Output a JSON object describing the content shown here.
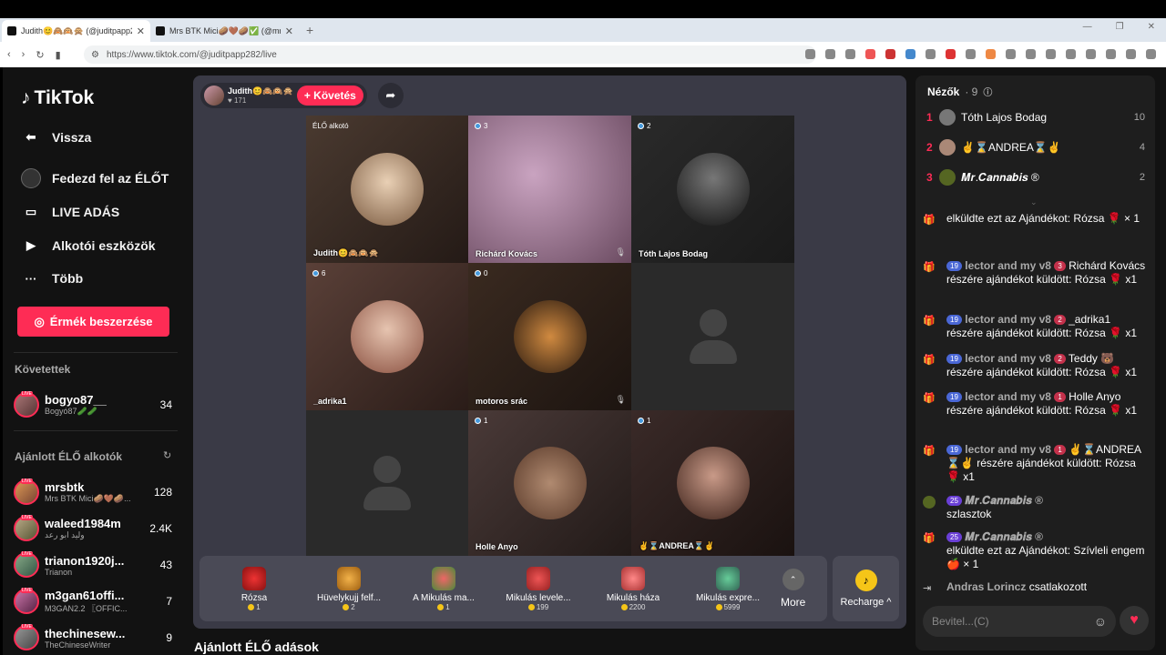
{
  "browser": {
    "tabs": [
      {
        "label": "Judith😊🙈🙉🙊 (@juditpapp282) TikTok LIVE",
        "active": true
      },
      {
        "label": "Mrs BTK Mici🥔🤎🥔✅ (@mrsbtk)",
        "active": false
      }
    ],
    "url": "https://www.tiktok.com/@juditpapp282/live"
  },
  "sidebar": {
    "logo": "TikTok",
    "back": "Vissza",
    "nav": [
      {
        "label": "Fedezd fel az ÉLŐT",
        "icon": "live-explore-icon"
      },
      {
        "label": "LIVE ADÁS",
        "icon": "video-camera-icon"
      },
      {
        "label": "Alkotói eszközök",
        "icon": "creator-tools-icon"
      },
      {
        "label": "Több",
        "icon": "more-dots-icon"
      }
    ],
    "coin_button": "Érmék beszerzése",
    "followed_heading": "Követettek",
    "followed": [
      {
        "name": "bogyo87__",
        "sub": "Bogyó87🥒🥒",
        "count": "34"
      }
    ],
    "recommended_heading": "Ajánlott ÉLŐ alkotók",
    "recommended": [
      {
        "name": "mrsbtk",
        "sub": "Mrs BTK Mici🥔🤎🥔...",
        "count": "128"
      },
      {
        "name": "waleed1984m",
        "sub": "وليد ابو رعد",
        "count": "2.4K"
      },
      {
        "name": "trianon1920j...",
        "sub": "Trianon",
        "count": "43"
      },
      {
        "name": "m3gan61offi...",
        "sub": "M3GAN2.2 〖OFFIC...",
        "count": "7"
      },
      {
        "name": "thechinesew...",
        "sub": "TheChineseWriter",
        "count": "9"
      }
    ]
  },
  "host": {
    "name": "Judith😊🙈🙉🙊",
    "likes": "171",
    "follow_label": "+ Követés"
  },
  "grid": [
    {
      "name": "Judith😊🙈🙉🙊",
      "count": "",
      "tag": "ÉLŐ alkotó",
      "muted": false
    },
    {
      "name": "Richárd Kovács",
      "count": "3",
      "tag": "",
      "muted": true
    },
    {
      "name": "Tóth Lajos Bodag",
      "count": "2",
      "tag": "",
      "muted": false
    },
    {
      "name": "_adrika1",
      "count": "6",
      "tag": "",
      "muted": false
    },
    {
      "name": "motoros srác",
      "count": "0",
      "tag": "",
      "muted": true
    },
    {
      "name": "",
      "count": "",
      "tag": "",
      "muted": false
    },
    {
      "name": "",
      "count": "",
      "tag": "",
      "muted": false
    },
    {
      "name": "Holle Anyo",
      "count": "1",
      "tag": "",
      "muted": false
    },
    {
      "name": "✌⌛ANDREA⌛✌",
      "count": "1",
      "tag": "",
      "muted": false
    }
  ],
  "gifts": [
    {
      "name": "Rózsa",
      "price": "1"
    },
    {
      "name": "Hüvelykujj felf...",
      "price": "2"
    },
    {
      "name": "A Mikulás ma...",
      "price": "1"
    },
    {
      "name": "Mikulás levele...",
      "price": "199"
    },
    {
      "name": "Mikulás háza",
      "price": "2200"
    },
    {
      "name": "Mikulás expre...",
      "price": "5999"
    }
  ],
  "more_label": "More",
  "recharge_label": "Recharge ^",
  "below_heading": "Ajánlott ÉLŐ adások",
  "viewers": {
    "title": "Nézők",
    "count": "· 9",
    "top": [
      {
        "rank": "1",
        "name": "Tóth Lajos Bodag",
        "score": "10"
      },
      {
        "rank": "2",
        "name": "✌⌛ANDREA⌛✌",
        "score": "4"
      },
      {
        "rank": "3",
        "name": "𝑴𝒓.𝑪𝒂𝒏𝒏𝒂𝒃𝒊𝒔 ®",
        "score": "2"
      }
    ]
  },
  "chat": [
    {
      "badge": "19",
      "level": "",
      "user": "lector and my v8",
      "text": "elküldte ezt az Ajándékot: Rózsa 🌹 × 1"
    },
    {
      "badge": "19",
      "level": "3",
      "user": "lector and my v8",
      "text": "Richárd Kovács részére ajándékot küldött: Rózsa 🌹 x1"
    },
    {
      "badge": "19",
      "level": "2",
      "user": "lector and my v8",
      "text": "_adrika1 részére ajándékot küldött: Rózsa 🌹 x1"
    },
    {
      "badge": "19",
      "level": "2",
      "user": "lector and my v8",
      "text": "Teddy 🐻 részére ajándékot küldött: Rózsa 🌹 x1"
    },
    {
      "badge": "19",
      "level": "1",
      "user": "lector and my v8",
      "text": "Holle Anyo részére ajándékot küldött: Rózsa 🌹 x1"
    },
    {
      "badge": "19",
      "level": "1",
      "user": "lector and my v8",
      "text": "✌⌛ANDREA⌛✌ részére ajándékot küldött: Rózsa 🌹 x1"
    },
    {
      "badge": "25",
      "level": "",
      "user": "𝑴𝒓.𝑪𝒂𝒏𝒏𝒂𝒃𝒊𝒔 ®",
      "text": "szlasztok"
    },
    {
      "badge": "25",
      "level": "",
      "user": "𝑴𝒓.𝑪𝒂𝒏𝒏𝒂𝒃𝒊𝒔 ®",
      "text": "elküldte ezt az Ajándékot: Szívleli engem 🍎 × 1"
    },
    {
      "badge": "",
      "level": "",
      "user": "Andras Lorincz",
      "text": "csatlakozott"
    }
  ],
  "chat_input_placeholder": "Bevitel...(C)",
  "colors": {
    "accent": "#fe2c55",
    "panel": "#1e1e1e",
    "stage": "#3a3a46"
  }
}
